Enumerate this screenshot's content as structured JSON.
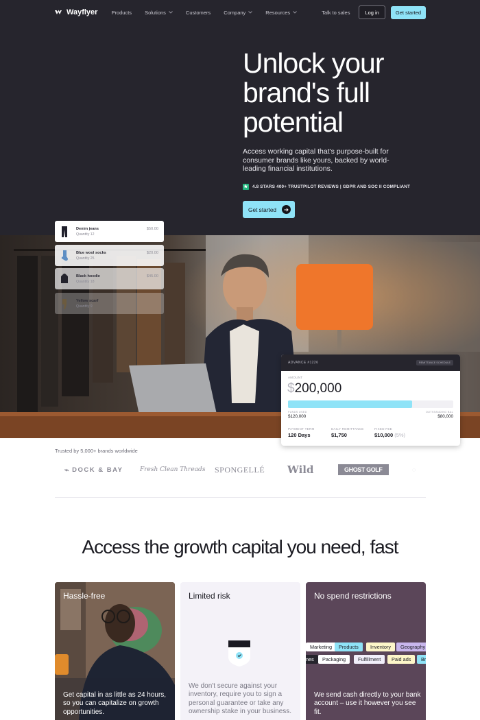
{
  "nav": {
    "brand": "Wayflyer",
    "links": [
      {
        "label": "Products",
        "dropdown": false
      },
      {
        "label": "Solutions",
        "dropdown": true
      },
      {
        "label": "Customers",
        "dropdown": false
      },
      {
        "label": "Company",
        "dropdown": true
      },
      {
        "label": "Resources",
        "dropdown": true
      }
    ],
    "talk_to_sales": "Talk to sales",
    "login": "Log in",
    "get_started": "Get started"
  },
  "hero": {
    "headline": "Unlock your brand's full potential",
    "subtext": "Access working capital that's purpose-built for consumer brands like yours, backed by world-leading financial institutions.",
    "rating": "4.8 STARS 400+ TRUSTPILOT REVIEWS | GDPR AND SOC II COMPLIANT",
    "cta": "Get started"
  },
  "inventory": [
    {
      "name": "Denim jeans",
      "qty": "Quantity 12",
      "price": "$50.00"
    },
    {
      "name": "Blue wool socks",
      "qty": "Quantity 25",
      "price": "$20.00"
    },
    {
      "name": "Black hoodie",
      "qty": "Quantity 18",
      "price": "$45.00"
    },
    {
      "name": "Yellow scarf",
      "qty": "Quantity 9",
      "price": ""
    }
  ],
  "advance": {
    "title": "ADVANCE #1226",
    "pill": "REMITTANCE SCHEDULE",
    "amount_label": "AMOUNT",
    "currency": "$",
    "amount": "200,000",
    "progress": 0.75,
    "left_label": "FUNDS USED",
    "left_value": "$120,000",
    "right_label": "OUTSTANDING BAL",
    "right_value": "$80,000",
    "payment_term_label": "PAYMENT TERM",
    "payment_term": "120 Days",
    "daily_label": "DAILY REMITTANCE",
    "daily": "$1,750",
    "fee_label": "FIXED FEE",
    "fee": "$10,000",
    "fee_pct": "(5%)"
  },
  "trusted": {
    "text": "Trusted by 5,000+ brands worldwide",
    "brands": [
      "DOCK & BAY",
      "Fresh Clean Threads",
      "SPONGELLÉ",
      "Wild",
      "GHOST GOLF"
    ]
  },
  "features": {
    "title": "Access the growth capital you need, fast",
    "cards": [
      {
        "title": "Hassle-free",
        "body": "Get capital in as little as 24 hours, so you can capitalize on growth opportunities."
      },
      {
        "title": "Limited risk",
        "body": "We don't secure against your inventory, require you to sign a personal guarantee or take any ownership stake in your business."
      },
      {
        "title": "No spend restrictions",
        "body": "We send cash directly to your bank account – use it however you see fit."
      }
    ],
    "tags_row1": [
      "Marketing",
      "Products",
      "Inventory",
      "Geography"
    ],
    "tags_row2": [
      "nes",
      "Packaging",
      "Fulfillment",
      "Paid ads",
      "Br"
    ]
  },
  "colors": {
    "hero_bg": "#26252d",
    "accent": "#8fe3f7",
    "tag_blue": "#8fe3f7",
    "tag_yellow": "#fdf6c9",
    "tag_purple": "#c8b6ec",
    "tag_white": "#ffffff"
  }
}
